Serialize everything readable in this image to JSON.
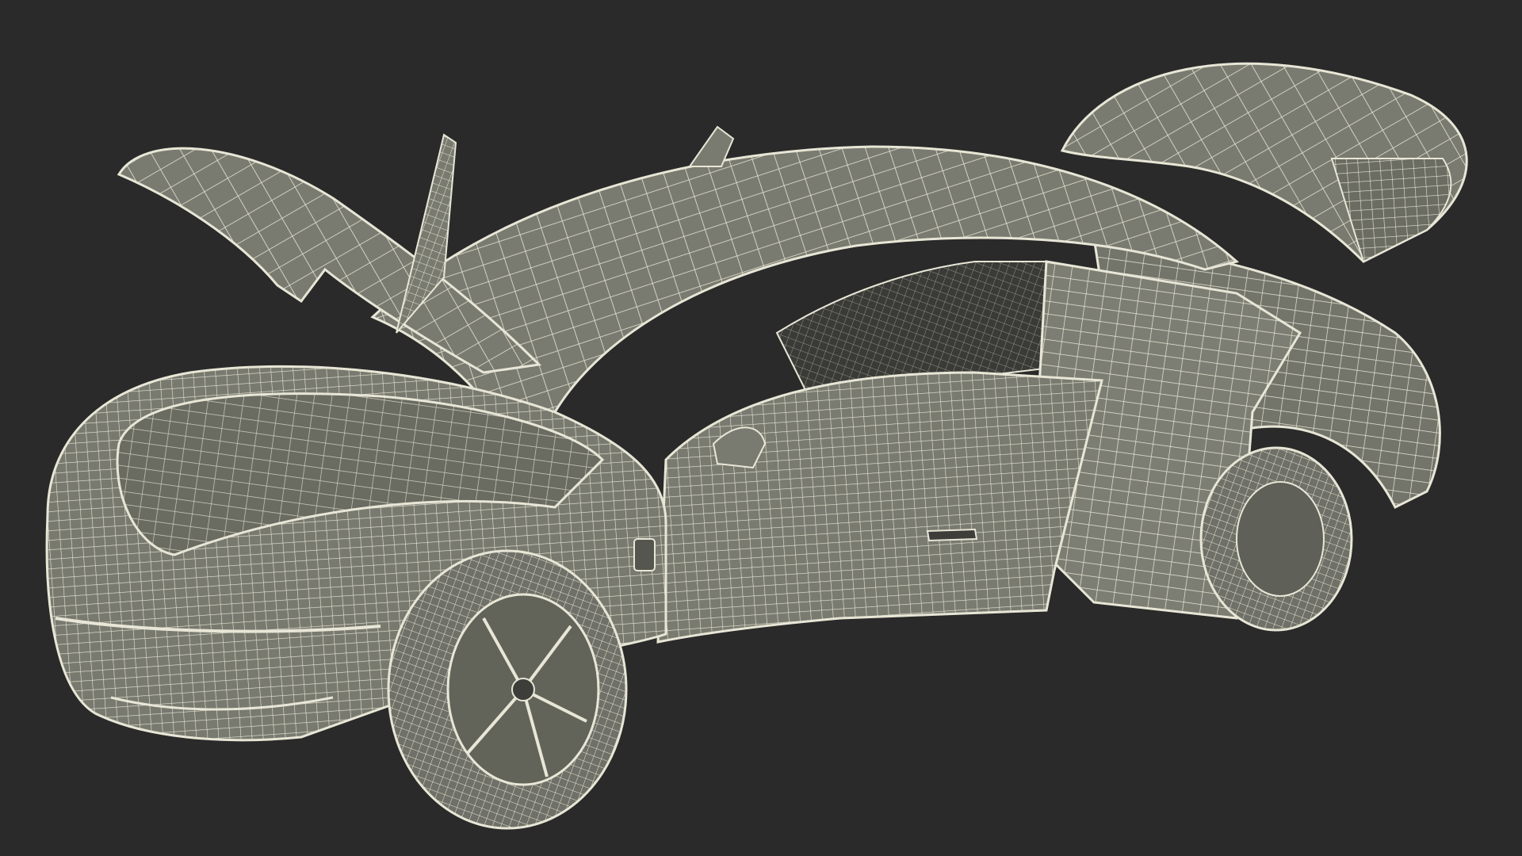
{
  "scene": {
    "subject": "car-wireframe-render",
    "colors": {
      "background": "#2a2a2a",
      "surface": "#7a7b70",
      "surface_dark": "#5f6058",
      "surface_light": "#8c8d82",
      "wire": "#e8e6d6",
      "shadow": "#3d3e3a"
    }
  }
}
